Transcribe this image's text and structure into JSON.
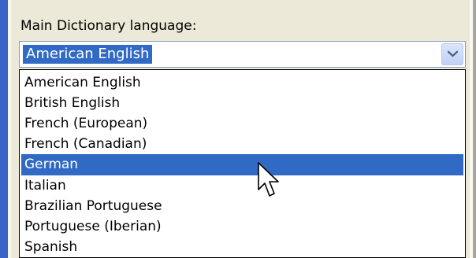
{
  "label": "Main Dictionary language:",
  "dropdown": {
    "selected_value": "American English",
    "open_button_icon": "chevron-down-icon",
    "options": [
      "American English",
      "British English",
      "French (European)",
      "French (Canadian)",
      "German",
      "Italian",
      "Brazilian Portuguese",
      "Portuguese (Iberian)",
      "Spanish"
    ],
    "highlighted_option": "German"
  },
  "pointer": "cursor-arrow-icon",
  "colors": {
    "selection": "#316ac5",
    "selected_text": "#ffffff",
    "panel": "#ece9d8",
    "left_accent": "#3a64c8",
    "field_border": "#7f9db9"
  }
}
